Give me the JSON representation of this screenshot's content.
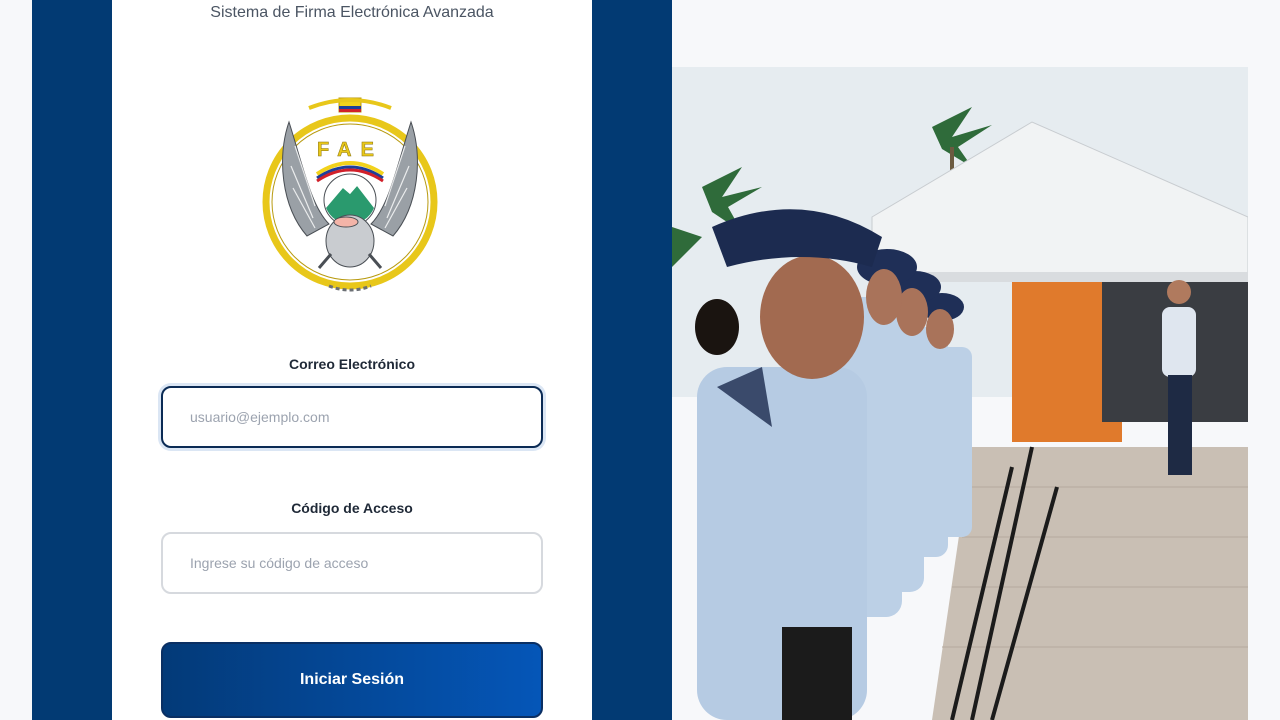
{
  "header": {
    "subtitle": "Sistema de Firma Electrónica Avanzada"
  },
  "logo": {
    "text": "FAE"
  },
  "form": {
    "email_label": "Correo Electrónico",
    "email_placeholder": "usuario@ejemplo.com",
    "email_value": "",
    "code_label": "Código de Acceso",
    "code_placeholder": "Ingrese su código de acceso",
    "code_value": "",
    "submit_label": "Iniciar Sesión"
  },
  "colors": {
    "side_panel": "#023a73",
    "card": "#ffffff",
    "button_start": "#033a78",
    "button_end": "#0556b8",
    "focus_border": "#0b2b55",
    "logo_gold": "#e8c71a"
  }
}
